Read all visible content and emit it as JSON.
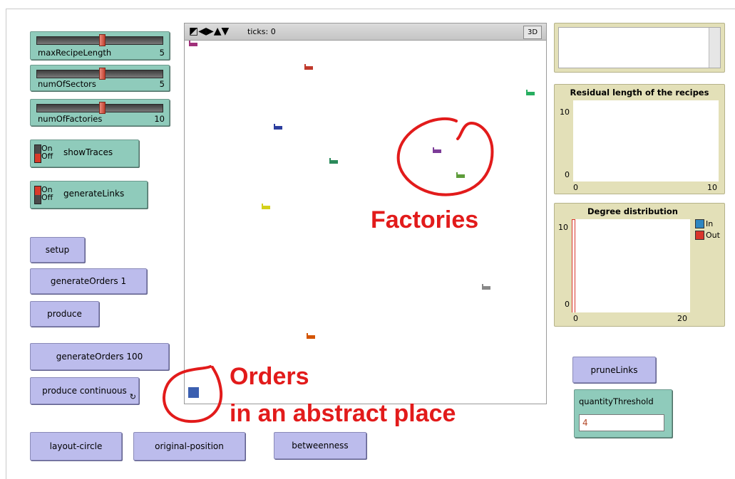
{
  "sliders": [
    {
      "label": "maxRecipeLength",
      "value": "5"
    },
    {
      "label": "numOfSectors",
      "value": "5"
    },
    {
      "label": "numOfFactories",
      "value": "10"
    }
  ],
  "switches": [
    {
      "on_label": "On",
      "off_label": "Off",
      "name": "showTraces",
      "state": "off"
    },
    {
      "on_label": "On",
      "off_label": "Off",
      "name": "generateLinks",
      "state": "on"
    }
  ],
  "buttons": {
    "setup": "setup",
    "generate_orders_1": "generateOrders 1",
    "produce": "produce",
    "generate_orders_100": "generateOrders 100",
    "produce_continuous": "produce continuous",
    "layout_circle": "layout-circle",
    "original_position": "original-position",
    "betweenness": "betweenness",
    "prune_links": "pruneLinks"
  },
  "view": {
    "ticks_label": "ticks: 0",
    "three_d_label": "3D",
    "controls_icon": "view-update-controls-icon",
    "turtle_colors": [
      "#a0307a",
      "#c0392b",
      "#27ae60",
      "#2c3e9e",
      "#7d3c98",
      "#2a8a5a",
      "#5d9c3a",
      "#d4d01a",
      "#888888",
      "#d35400"
    ]
  },
  "plots": {
    "residual": {
      "title": "Residual length of the recipes",
      "y_max": "10",
      "y_min": "0",
      "x_min": "0",
      "x_max": "10"
    },
    "degree": {
      "title": "Degree distribution",
      "y_max": "10",
      "y_min": "0",
      "x_min": "0",
      "x_max": "20",
      "legend": [
        {
          "name": "In",
          "color": "#2e86c1"
        },
        {
          "name": "Out",
          "color": "#d9362b"
        }
      ]
    }
  },
  "input": {
    "label": "quantityThreshold",
    "value": "4"
  },
  "annotations": {
    "factories": "Factories",
    "orders": "Orders",
    "orders_sub": "in an abstract place",
    "color": "#e21b1b"
  }
}
